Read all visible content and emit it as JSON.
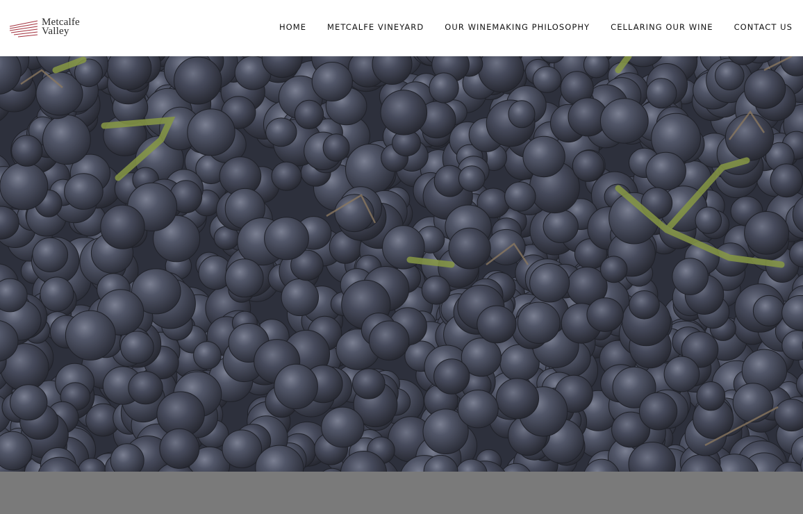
{
  "brand": {
    "line1": "Metcalfe",
    "line2": "Valley",
    "logo_icon": "vineyard-rows-icon",
    "logo_color": "#a3303d"
  },
  "nav": {
    "items": [
      {
        "label": "HOME"
      },
      {
        "label": "METCALFE VINEYARD"
      },
      {
        "label": "OUR WINEMAKING PHILOSOPHY"
      },
      {
        "label": "CELLARING OUR WINE"
      },
      {
        "label": "CONTACT US"
      }
    ]
  },
  "hero": {
    "image": "grapes-photo",
    "colors": {
      "grape_dark": "#3e4252",
      "grape_mid": "#5b6176",
      "stem": "#9cb14a"
    }
  },
  "footer": {
    "background": "#7a7a7a"
  }
}
